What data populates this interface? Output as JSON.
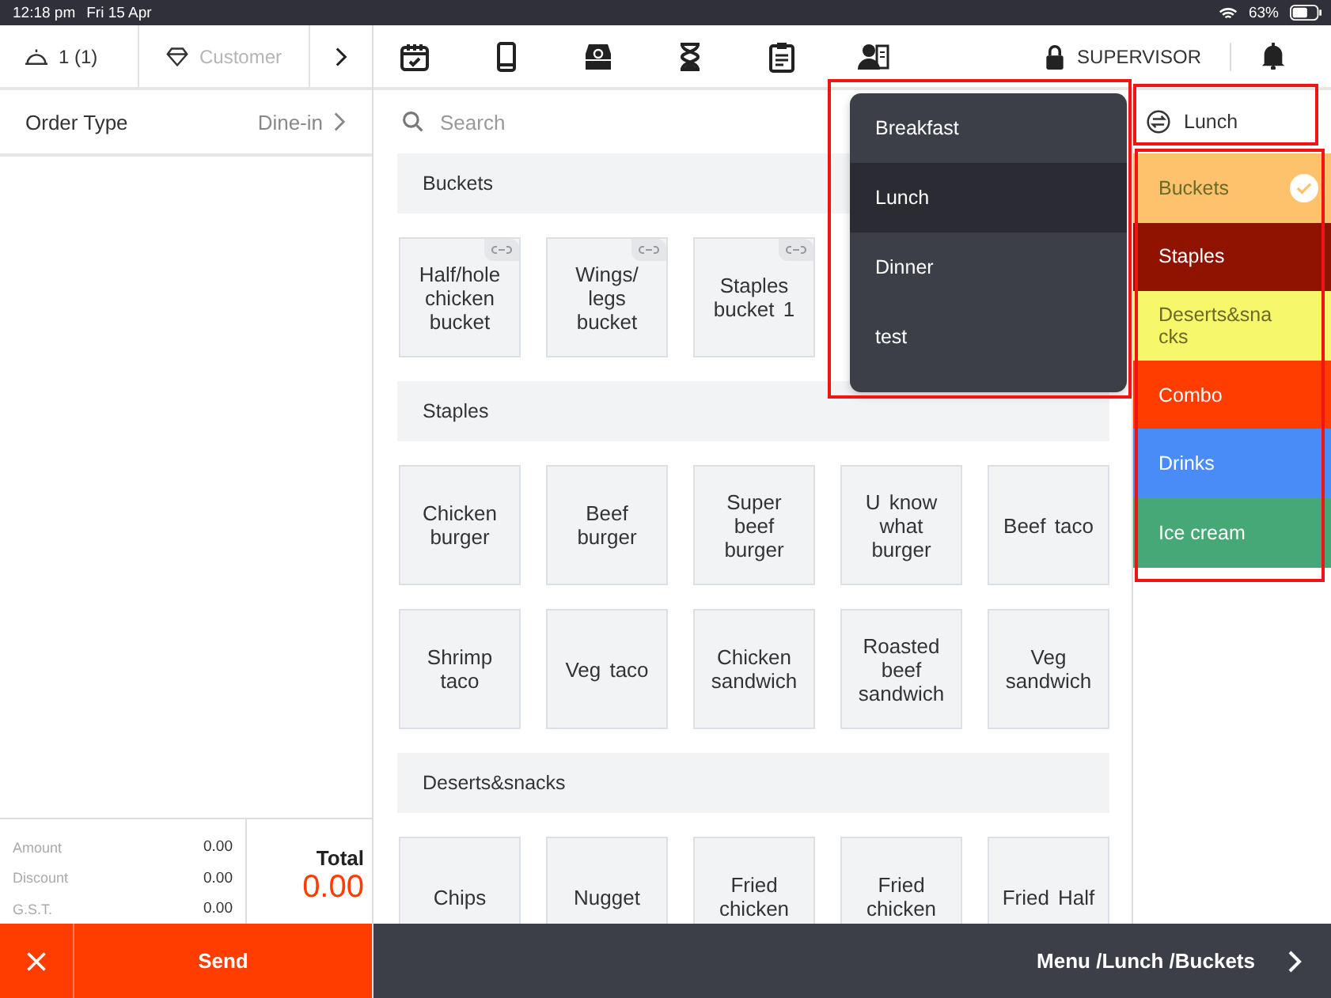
{
  "status_bar": {
    "time": "12:18 pm",
    "date": "Fri 15 Apr",
    "battery": "63%"
  },
  "order_header": {
    "guests": "1 (1)",
    "customer": "Customer"
  },
  "toolbar": {
    "role": "SUPERVISOR"
  },
  "order_type": {
    "label": "Order Type",
    "value": "Dine-in"
  },
  "search": {
    "placeholder": "Search"
  },
  "sections": [
    {
      "title": "Buckets",
      "items": [
        {
          "name": "Half/hole chicken bucket",
          "linked": true
        },
        {
          "name": "Wings/ legs bucket",
          "linked": true
        },
        {
          "name": "Staples bucket 1",
          "linked": true
        }
      ]
    },
    {
      "title": "Staples",
      "items": [
        {
          "name": "Chicken burger",
          "linked": false
        },
        {
          "name": "Beef burger",
          "linked": false
        },
        {
          "name": "Super beef burger",
          "linked": false
        },
        {
          "name": "U know what burger",
          "linked": false
        },
        {
          "name": "Beef taco",
          "linked": false
        },
        {
          "name": "Shrimp taco",
          "linked": false
        },
        {
          "name": "Veg taco",
          "linked": false
        },
        {
          "name": "Chicken sandwich",
          "linked": false
        },
        {
          "name": "Roasted beef sandwich",
          "linked": false
        },
        {
          "name": "Veg sandwich",
          "linked": false
        }
      ]
    },
    {
      "title": "Deserts&snacks",
      "items": [
        {
          "name": "Chips",
          "linked": false
        },
        {
          "name": "Nugget",
          "linked": false
        },
        {
          "name": "Fried chicken",
          "linked": false
        },
        {
          "name": "Fried chicken",
          "linked": false
        },
        {
          "name": "Fried Half",
          "linked": false
        }
      ]
    }
  ],
  "menu_dropdown": {
    "highlighted": true,
    "options": [
      {
        "label": "Breakfast",
        "selected": false
      },
      {
        "label": "Lunch",
        "selected": true
      },
      {
        "label": "Dinner",
        "selected": false
      },
      {
        "label": "test",
        "selected": false
      }
    ]
  },
  "menu_button": {
    "label": "Lunch",
    "highlighted": true
  },
  "categories": {
    "highlighted": true,
    "items": [
      {
        "label": "Buckets",
        "color": "#fdc26b",
        "selected": true
      },
      {
        "label": "Staples",
        "color": "#8f1300",
        "selected": false
      },
      {
        "label": "Deserts&snacks",
        "color": "#f6f76b",
        "selected": false
      },
      {
        "label": "Combo",
        "color": "#ff3d00",
        "selected": false
      },
      {
        "label": "Drinks",
        "color": "#4a8cf7",
        "selected": false
      },
      {
        "label": "Ice cream",
        "color": "#47a877",
        "selected": false
      }
    ]
  },
  "totals": {
    "rows": [
      {
        "label": "Amount",
        "value": "0.00"
      },
      {
        "label": "Discount",
        "value": "0.00"
      },
      {
        "label": "G.S.T.",
        "value": "0.00"
      }
    ],
    "total_label": "Total",
    "total": "0.00"
  },
  "actions": {
    "send": "Send"
  },
  "breadcrumb": "Menu /Lunch /Buckets"
}
